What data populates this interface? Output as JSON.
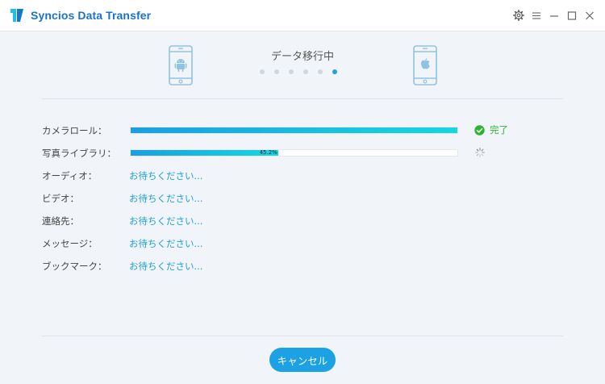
{
  "window": {
    "title": "Syncios Data Transfer",
    "controls": [
      "gear-icon",
      "menu-icon",
      "minimize-icon",
      "maximize-icon",
      "close-icon"
    ]
  },
  "transfer": {
    "source_device": "android",
    "target_device": "apple",
    "status_title": "データ移行中",
    "step_dots_total": 6,
    "step_dots_active": 6
  },
  "items": [
    {
      "label": "カメラロール：",
      "state": "done",
      "progress": 100,
      "status_text": "完了"
    },
    {
      "label": "写真ライブラリ：",
      "state": "in-progress",
      "progress": 45.2,
      "progress_text": "45.2%"
    },
    {
      "label": "オーディオ：",
      "state": "waiting",
      "status_text": "お待ちください..."
    },
    {
      "label": "ビデオ：",
      "state": "waiting",
      "status_text": "お待ちください..."
    },
    {
      "label": "連絡先：",
      "state": "waiting",
      "status_text": "お待ちください..."
    },
    {
      "label": "メッセージ：",
      "state": "waiting",
      "status_text": "お待ちください..."
    },
    {
      "label": "ブックマーク：",
      "state": "waiting",
      "status_text": "お待ちください..."
    }
  ],
  "footer": {
    "cancel_label": "キャンセル"
  },
  "colors": {
    "accent": "#1ba1e4",
    "title": "#1a73c9",
    "success": "#2bb334",
    "progress_start": "#1a9fe0",
    "progress_end": "#16d7e0",
    "background": "#f1f4f8"
  }
}
